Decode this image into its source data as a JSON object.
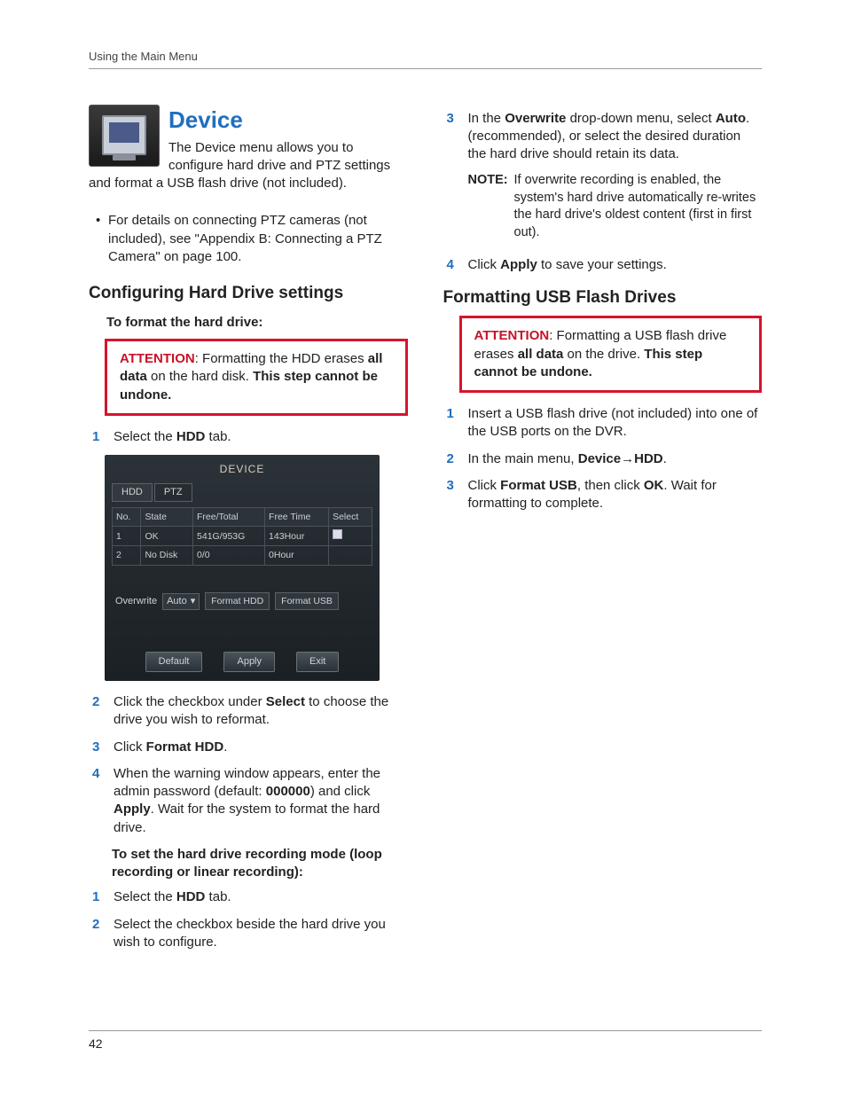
{
  "header": "Using the Main Menu",
  "page_number": "42",
  "left": {
    "title": "Device",
    "intro": "The Device menu allows you to configure hard drive and PTZ settings and format a USB flash drive (not included).",
    "bullet": "For details on connecting PTZ cameras (not included), see \"Appendix B: Connecting a PTZ Camera\" on page 100.",
    "sec1": "Configuring Hard Drive settings",
    "sub1": "To format the hard drive:",
    "att1_label": "ATTENTION",
    "att1_a": ": Formatting the HDD erases ",
    "att1_b": "all data",
    "att1_c": " on the hard disk. ",
    "att1_d": "This step cannot be undone.",
    "s1_pre": "Select the ",
    "s1_b": "HDD",
    "s1_post": " tab.",
    "shot": {
      "title": "DEVICE",
      "tab1": "HDD",
      "tab2": "PTZ",
      "h_no": "No.",
      "h_state": "State",
      "h_ft": "Free/Total",
      "h_time": "Free Time",
      "h_sel": "Select",
      "r1_no": "1",
      "r1_state": "OK",
      "r1_ft": "541G/953G",
      "r1_time": "143Hour",
      "r2_no": "2",
      "r2_state": "No Disk",
      "r2_ft": "0/0",
      "r2_time": "0Hour",
      "ow_label": "Overwrite",
      "ow_val": "Auto",
      "fmt_hdd": "Format HDD",
      "fmt_usb": "Format USB",
      "b_def": "Default",
      "b_apply": "Apply",
      "b_exit": "Exit"
    },
    "s2_a": "Click the checkbox under ",
    "s2_b": "Select",
    "s2_c": " to choose the drive you wish to reformat.",
    "s3_a": "Click ",
    "s3_b": "Format HDD",
    "s3_c": ".",
    "s4_a": "When the warning window appears, enter the admin password (default: ",
    "s4_b": "000000",
    "s4_c": ") and click ",
    "s4_d": "Apply",
    "s4_e": ". Wait for the system to format the hard drive.",
    "sub2": "To set the hard drive recording mode (loop recording or linear recording):",
    "m1_a": "Select the ",
    "m1_b": "HDD",
    "m1_c": " tab.",
    "m2": "Select the checkbox beside the hard drive you wish to configure."
  },
  "right": {
    "s3_a": "In the ",
    "s3_b": "Overwrite",
    "s3_c": " drop-down menu, select ",
    "s3_d": "Auto",
    "s3_e": ". (recommended), or select the desired duration the hard drive should retain its data.",
    "note_label": "NOTE:",
    "note_text": "If overwrite recording is enabled, the system's hard drive automatically re-writes the hard drive's oldest content (first in first out).",
    "s4_a": "Click ",
    "s4_b": "Apply",
    "s4_c": " to save your settings.",
    "sec2": "Formatting USB Flash Drives",
    "att2_label": "ATTENTION",
    "att2_a": ": Formatting a USB flash drive erases ",
    "att2_b": "all data",
    "att2_c": " on the drive. ",
    "att2_d": "This step cannot be undone.",
    "u1": "Insert a USB flash drive (not included) into one of the USB ports on the DVR.",
    "u2_a": "In the main menu, ",
    "u2_b": "Device",
    "u2_c": "HDD",
    "u2_d": ".",
    "u3_a": "Click ",
    "u3_b": "Format USB",
    "u3_c": ", then click ",
    "u3_d": "OK",
    "u3_e": ". Wait for formatting to complete."
  }
}
